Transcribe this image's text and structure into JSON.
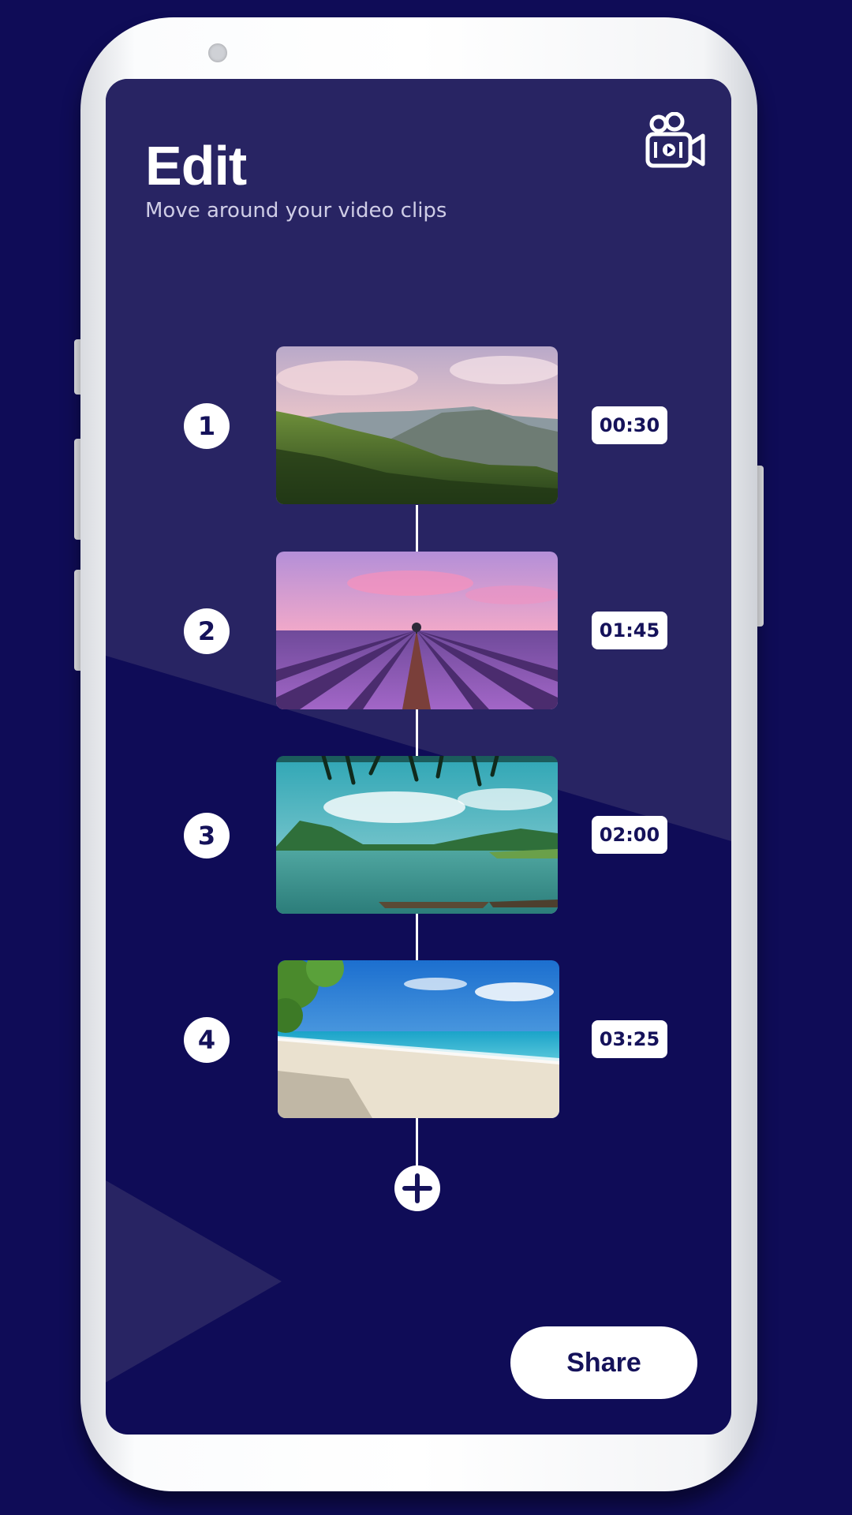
{
  "header": {
    "title": "Edit",
    "subtitle": "Move around your video clips",
    "app_icon": "video-camera-icon"
  },
  "clips": [
    {
      "number": "1",
      "duration": "00:30",
      "scene": "forest-hills"
    },
    {
      "number": "2",
      "duration": "01:45",
      "scene": "lavender-field"
    },
    {
      "number": "3",
      "duration": "02:00",
      "scene": "lake-mountains"
    },
    {
      "number": "4",
      "duration": "03:25",
      "scene": "tropical-beach"
    }
  ],
  "actions": {
    "add_icon": "plus-icon",
    "share_label": "Share"
  },
  "colors": {
    "background": "#0f0c57",
    "panel_light": "#282463",
    "accent_text": "#15125a",
    "white": "#ffffff"
  }
}
